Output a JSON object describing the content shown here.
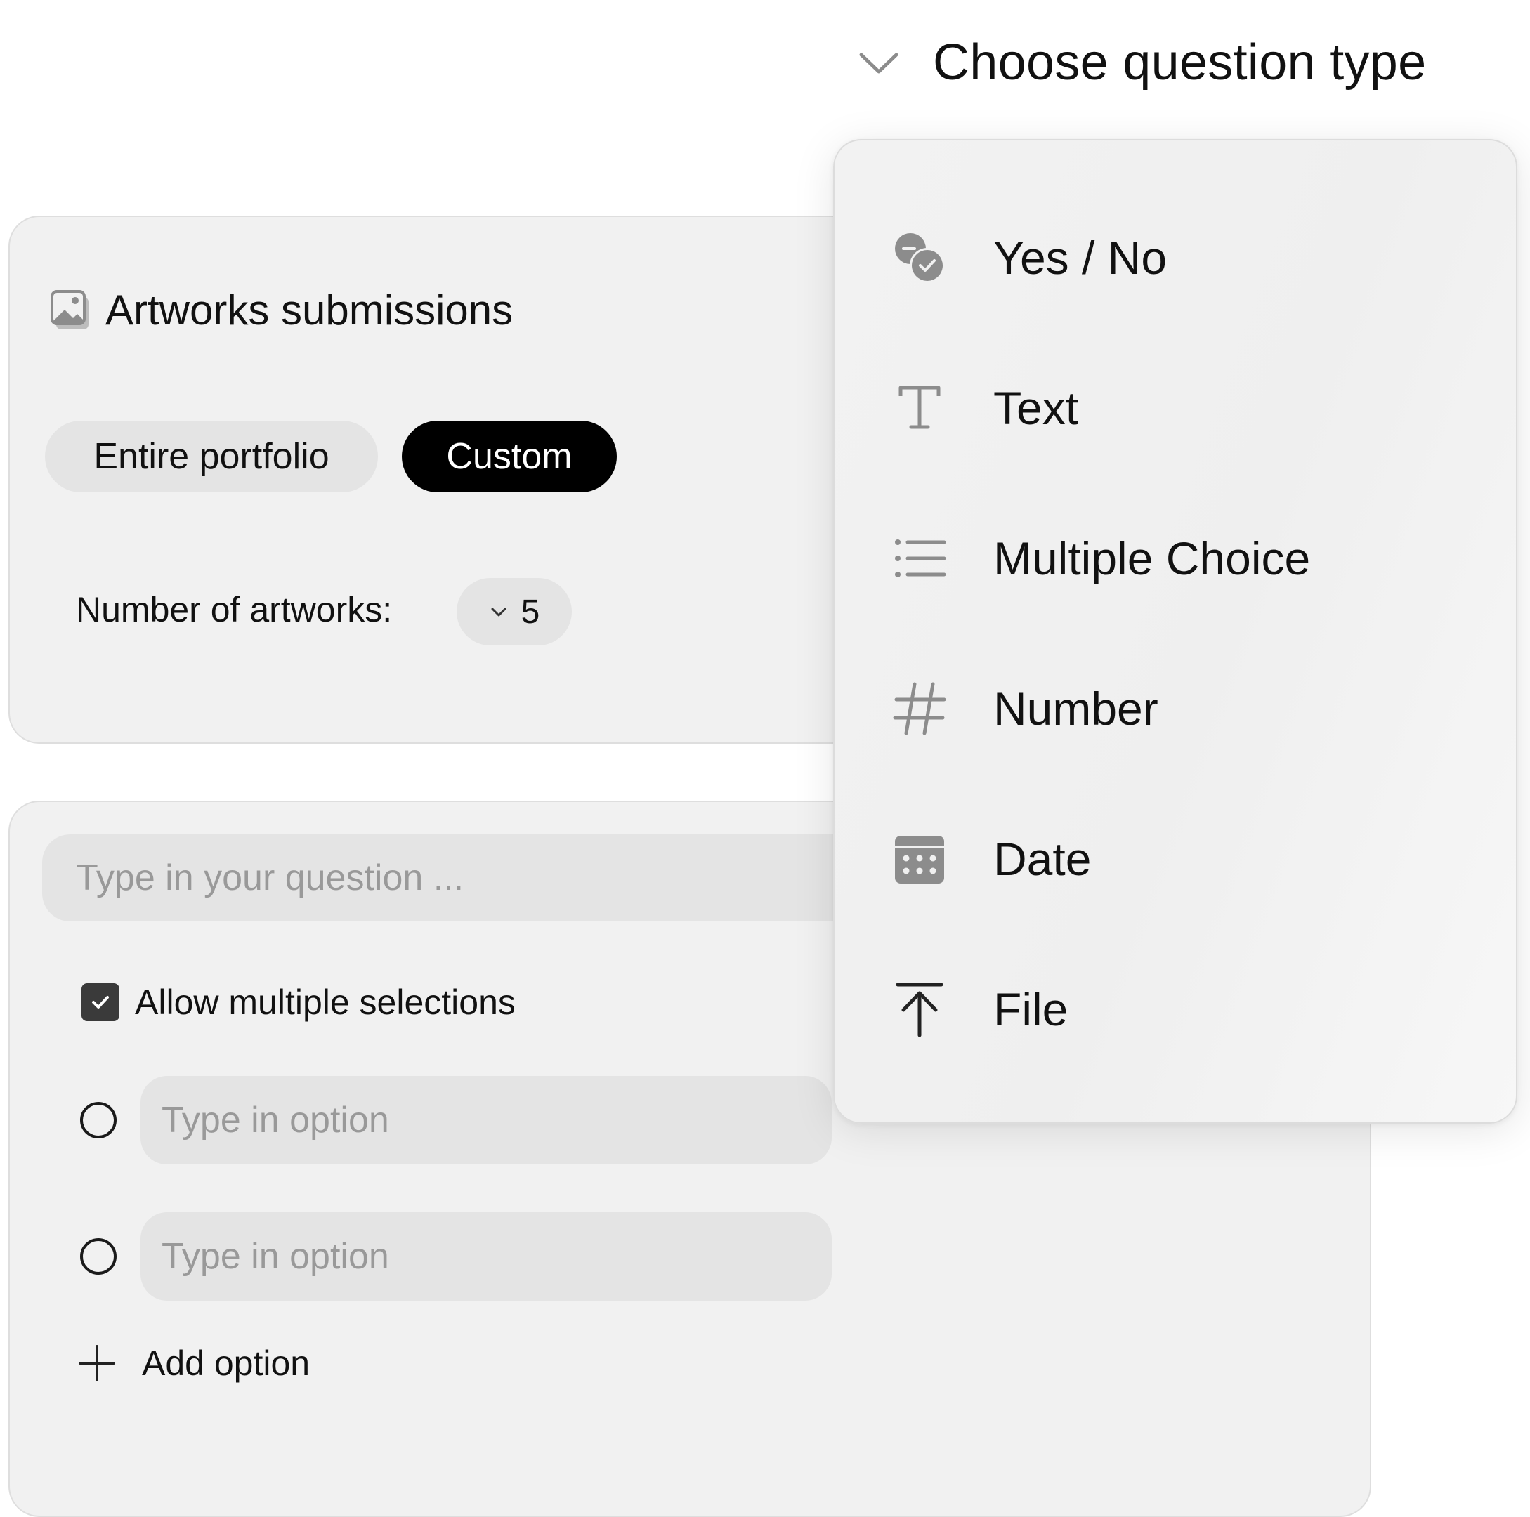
{
  "header": {
    "choose_type_label": "Choose question type",
    "chevron_icon": "chevron-down-icon"
  },
  "artworks_card": {
    "title": "Artworks submissions",
    "title_icon": "image-icon",
    "scope_options": [
      "Entire portfolio",
      "Custom"
    ],
    "scope_selected": "Custom",
    "number_label": "Number of artworks:",
    "number_value": "5"
  },
  "question_card": {
    "question_placeholder": "Type in your question ...",
    "allow_multiple_label": "Allow multiple selections",
    "allow_multiple_checked": true,
    "options": [
      {
        "placeholder": "Type in option",
        "value": ""
      },
      {
        "placeholder": "Type in option",
        "value": ""
      }
    ],
    "add_option_label": "Add option"
  },
  "type_menu": {
    "items": [
      {
        "label": "Yes / No",
        "icon": "yes-no-icon"
      },
      {
        "label": "Text",
        "icon": "text-type-icon"
      },
      {
        "label": "Multiple Choice",
        "icon": "list-icon"
      },
      {
        "label": "Number",
        "icon": "hash-icon"
      },
      {
        "label": "Date",
        "icon": "calendar-icon"
      },
      {
        "label": "File",
        "icon": "upload-icon"
      }
    ]
  },
  "colors": {
    "card_bg": "#f1f1f1",
    "input_bg": "#e4e4e4",
    "selected_pill_bg": "#000000",
    "icon_gray": "#8c8c8c",
    "placeholder": "#999999"
  }
}
